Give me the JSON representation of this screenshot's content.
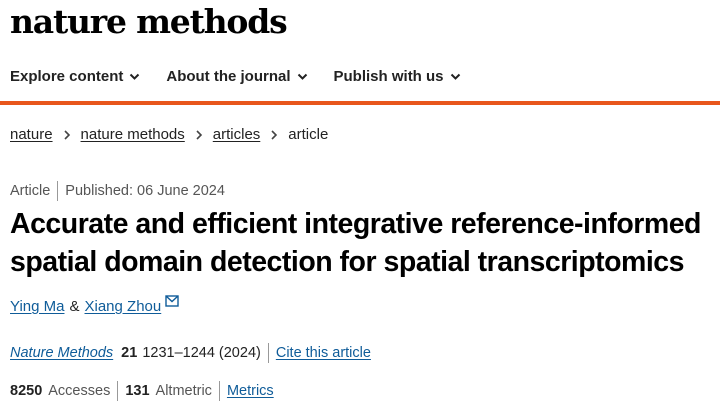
{
  "site": {
    "logo": "nature methods"
  },
  "nav": {
    "items": [
      {
        "label": "Explore content"
      },
      {
        "label": "About the journal"
      },
      {
        "label": "Publish with us"
      }
    ]
  },
  "colors": {
    "accent": "#e8561c",
    "link": "#0f5c99"
  },
  "breadcrumb": {
    "items": [
      "nature",
      "nature methods",
      "articles"
    ],
    "current": "article"
  },
  "article": {
    "type": "Article",
    "published": "Published: 06 June 2024",
    "title_line1": "Accurate and efficient integrative reference-informed",
    "title_line2": "spatial domain detection for spatial transcriptomics",
    "authors": [
      "Ying Ma",
      "Xiang Zhou"
    ],
    "author_separator": "&",
    "journal": "Nature Methods",
    "volume": "21",
    "pages_year": "1231–1244 (2024)",
    "cite_label": "Cite this article"
  },
  "metrics": {
    "accesses_value": "8250",
    "accesses_label": "Accesses",
    "altmetric_value": "131",
    "altmetric_label": "Altmetric",
    "metrics_link": "Metrics"
  }
}
